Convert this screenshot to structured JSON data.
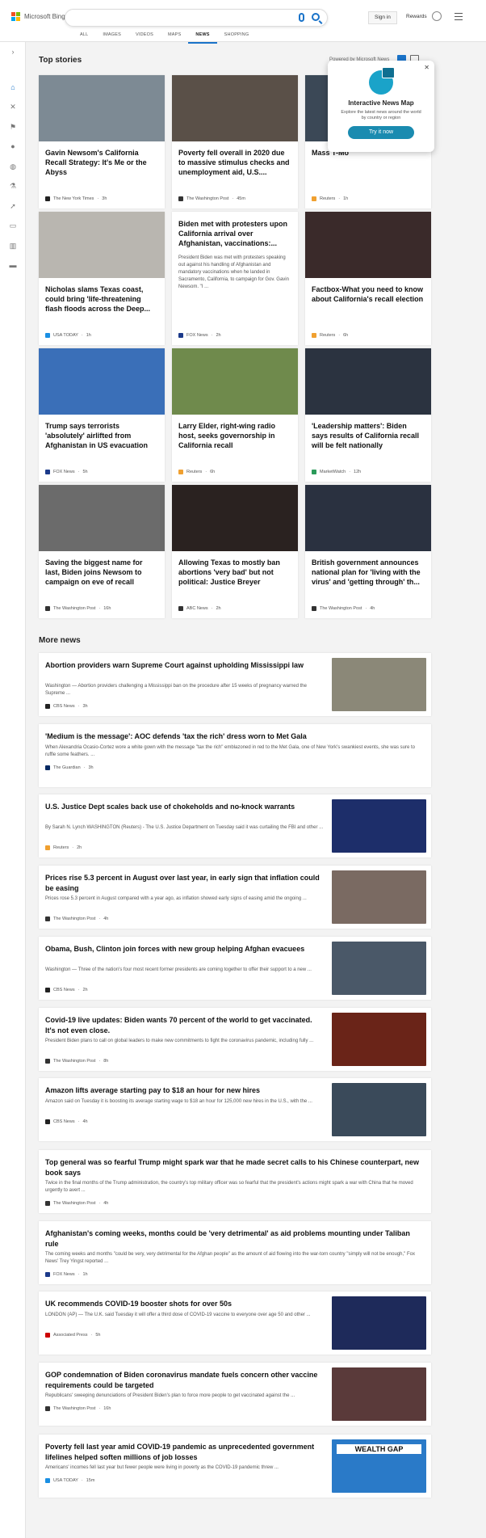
{
  "header": {
    "brand": "Microsoft Bing",
    "sign_in": "Sign in",
    "rewards": "Rewards",
    "logo_colors": [
      "#f25022",
      "#7fba00",
      "#00a4ef",
      "#ffb900"
    ],
    "tabs": [
      {
        "label": "ALL"
      },
      {
        "label": "IMAGES"
      },
      {
        "label": "VIDEOS"
      },
      {
        "label": "MAPS"
      },
      {
        "label": "NEWS",
        "active": true
      },
      {
        "label": "SHOPPING"
      }
    ]
  },
  "rail": {
    "icons": [
      "expand-icon",
      "home-icon",
      "tools-icon",
      "flag-icon",
      "location-icon",
      "globe-icon",
      "science-icon",
      "rocket-icon",
      "film-icon",
      "bank-icon",
      "card-icon"
    ]
  },
  "top_stories": {
    "title": "Top stories",
    "powered": "Powered by Microsoft News"
  },
  "popup": {
    "title": "Interactive News Map",
    "desc": "Explore the latest news around the world by country or region",
    "button": "Try it now"
  },
  "stories": [
    {
      "title": "Gavin Newsom's California Recall Strategy: It's Me or the Abyss",
      "source": "The New York Times",
      "time": "3h",
      "img": "#7d8a94",
      "icon": "#222"
    },
    {
      "title": "Poverty fell overall in 2020 due to massive stimulus checks and unemployment aid, U.S....",
      "source": "The Washington Post",
      "time": "45m",
      "img": "#5a5048",
      "icon": "#333"
    },
    {
      "title": "Mass T-Mo",
      "source": "Reuters",
      "time": "1h",
      "img": "#3b4856",
      "icon": "#f0a030"
    },
    {
      "title": "Nicholas slams Texas coast, could bring 'life-threatening flash floods across the Deep...",
      "source": "USA TODAY",
      "time": "1h",
      "img": "#b9b6b0",
      "icon": "#1a8fe3"
    },
    {
      "title": "Biden met with protesters upon California arrival over Afghanistan, vaccinations:...",
      "snippet": "President Biden was met with protesters speaking out against his handling of Afghanistan and mandatory vaccinations when he landed in Sacramento, California, to campaign for Gov. Gavin Newsom. \"I ...",
      "source": "FOX News",
      "time": "2h",
      "icon": "#1c3a8a"
    },
    {
      "title": "Factbox-What you need to know about California's recall election",
      "source": "Reuters",
      "time": "6h",
      "img": "#3a2a2a",
      "icon": "#f0a030"
    },
    {
      "title": "Trump says terrorists 'absolutely' airlifted from Afghanistan in US evacuation",
      "source": "FOX News",
      "time": "5h",
      "img": "#3a6fb8",
      "icon": "#1c3a8a"
    },
    {
      "title": "Larry Elder, right-wing radio host, seeks governorship in California recall",
      "source": "Reuters",
      "time": "6h",
      "img": "#6f8a4c",
      "icon": "#f0a030"
    },
    {
      "title": "'Leadership matters': Biden says results of California recall will be felt nationally",
      "source": "MarketWatch",
      "time": "12h",
      "img": "#2b3340",
      "icon": "#2b9a5a"
    },
    {
      "title": "Saving the biggest name for last, Biden joins Newsom to campaign on eve of recall",
      "source": "The Washington Post",
      "time": "16h",
      "img": "#6b6b6b",
      "icon": "#333"
    },
    {
      "title": "Allowing Texas to mostly ban abortions 'very bad' but not political: Justice Breyer",
      "source": "ABC News",
      "time": "2h",
      "img": "#2a2220",
      "icon": "#333"
    },
    {
      "title": "British government announces national plan for 'living with the virus' and 'getting through' th...",
      "source": "The Washington Post",
      "time": "4h",
      "img": "#2a3140",
      "icon": "#333"
    }
  ],
  "more_news": {
    "title": "More news",
    "items": [
      {
        "title": "Abortion providers warn Supreme Court against upholding Mississippi law",
        "snippet": "Washington — Abortion providers challenging a Mississippi ban on the procedure after 15 weeks of pregnancy warned the Supreme ...",
        "source": "CBS News",
        "time": "3h",
        "img": "#8b8878",
        "icon": "#222"
      },
      {
        "title": "'Medium is the message': AOC defends 'tax the rich' dress worn to Met Gala",
        "snippet": "When Alexandria Ocasio-Cortez wore a white gown with the message \"tax the rich\" emblazoned in red to the Met Gala, one of New York's swankiest events, she was sure to ruffle some feathers. ...",
        "source": "The Guardian",
        "time": "3h",
        "icon": "#052962"
      },
      {
        "title": "U.S. Justice Dept scales back use of chokeholds and no-knock warrants",
        "snippet": "By Sarah N. Lynch WASHINGTON (Reuters) - The U.S. Justice Department on Tuesday said it was curtailing the FBI and other ...",
        "source": "Reuters",
        "time": "2h",
        "img": "#1d2e6a",
        "icon": "#f0a030"
      },
      {
        "title": "Prices rise 5.3 percent in August over last year, in early sign that inflation could be easing",
        "snippet": "Prices rose 5.3 percent in August compared with a year ago, as inflation showed early signs of easing amid the ongoing ...",
        "source": "The Washington Post",
        "time": "4h",
        "img": "#7a6a62",
        "icon": "#333"
      },
      {
        "title": "Obama, Bush, Clinton join forces with new group helping Afghan evacuees",
        "snippet": "Washington — Three of the nation's four most recent former presidents are coming together to offer their support to a new ...",
        "source": "CBS News",
        "time": "2h",
        "img": "#4a5868",
        "icon": "#222"
      },
      {
        "title": "Covid-19 live updates: Biden wants 70 percent of the world to get vaccinated. It's not even close.",
        "snippet": "President Biden plans to call on global leaders to make new commitments to fight the coronavirus pandemic, including fully ...",
        "source": "The Washington Post",
        "time": "8h",
        "img": "#6a2418",
        "icon": "#333"
      },
      {
        "title": "Amazon lifts average starting pay to $18 an hour for new hires",
        "snippet": "Amazon said on Tuesday it is boosting its average starting wage to $18 an hour for 125,000 new hires in the U.S., with the ...",
        "source": "CBS News",
        "time": "4h",
        "img": "#3a4a5a",
        "icon": "#222"
      },
      {
        "title": "Top general was so fearful Trump might spark war that he made secret calls to his Chinese counterpart, new book says",
        "snippet": "Twice in the final months of the Trump administration, the country's top military officer was so fearful that the president's actions might spark a war with China that he moved urgently to avert ...",
        "source": "The Washington Post",
        "time": "4h",
        "icon": "#333"
      },
      {
        "title": "Afghanistan's coming weeks, months could be 'very detrimental' as aid problems mounting under Taliban rule",
        "snippet": "The coming weeks and months \"could be very, very detrimental for the Afghan people\" as the amount of aid flowing into the war-torn country \"simply will not be enough,\" Fox News' Trey Yingst reported ...",
        "source": "FOX News",
        "time": "1h",
        "icon": "#1c3a8a"
      },
      {
        "title": "UK recommends COVID-19 booster shots for over 50s",
        "snippet": "LONDON (AP) — The U.K. said Tuesday it will offer a third dose of COVID-19 vaccine to everyone over age 50 and other ...",
        "source": "Associated Press",
        "time": "5h",
        "img": "#1e2a5a",
        "icon": "#c00"
      },
      {
        "title": "GOP condemnation of Biden coronavirus mandate fuels concern other vaccine requirements could be targeted",
        "snippet": "Republicans' sweeping denunciations of President Biden's plan to force more people to get vaccinated against the ...",
        "source": "The Washington Post",
        "time": "16h",
        "img": "#5a3a3a",
        "icon": "#333"
      },
      {
        "title": "Poverty fell last year amid COVID-19 pandemic as unprecedented government lifelines helped soften millions of job losses",
        "snippet": "Americans' incomes fell last year but fewer people were living in poverty as the COVID-19 pandemic threw ...",
        "source": "USA TODAY",
        "time": "15m",
        "img": "#2a7ac8",
        "img_text": "WEALTH GAP",
        "icon": "#1a8fe3"
      }
    ]
  }
}
